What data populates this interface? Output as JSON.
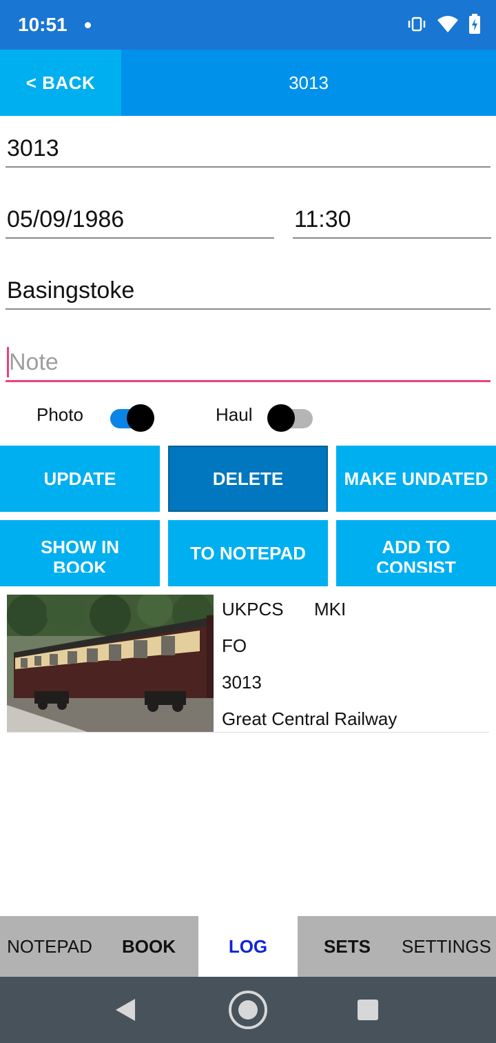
{
  "status_bar": {
    "time": "10:51"
  },
  "header": {
    "back_label": "< BACK",
    "title": "3013"
  },
  "form": {
    "number": "3013",
    "date": "05/09/1986",
    "time": "11:30",
    "location": "Basingstoke",
    "note_placeholder": "Note"
  },
  "toggles": {
    "photo": {
      "label": "Photo",
      "state": "on"
    },
    "haul": {
      "label": "Haul",
      "state": "off"
    }
  },
  "buttons": {
    "update": "UPDATE",
    "delete": "DELETE",
    "make_undated": "MAKE UNDATED",
    "show_in_book": "SHOW IN BOOK",
    "to_notepad": "TO NOTEPAD",
    "add_to_consist": "ADD TO CONSIST"
  },
  "card": {
    "code": "UKPCS",
    "mark": "MKI",
    "type": "FO",
    "number": "3013",
    "railway": "Great Central Railway"
  },
  "tabs": {
    "notepad": "NOTEPAD",
    "book": "BOOK",
    "log": "LOG",
    "sets": "SETS",
    "settings": "SETTINGS",
    "active": "LOG"
  },
  "colors": {
    "status_bar": "#1976d2",
    "header": "#0091ea",
    "button": "#00aff0",
    "button_pressed": "#0077bf",
    "note_underline": "#ec407a",
    "active_tab_text": "#0d24d6",
    "tabbar": "#b2b2b2",
    "navbar": "#47525b"
  }
}
